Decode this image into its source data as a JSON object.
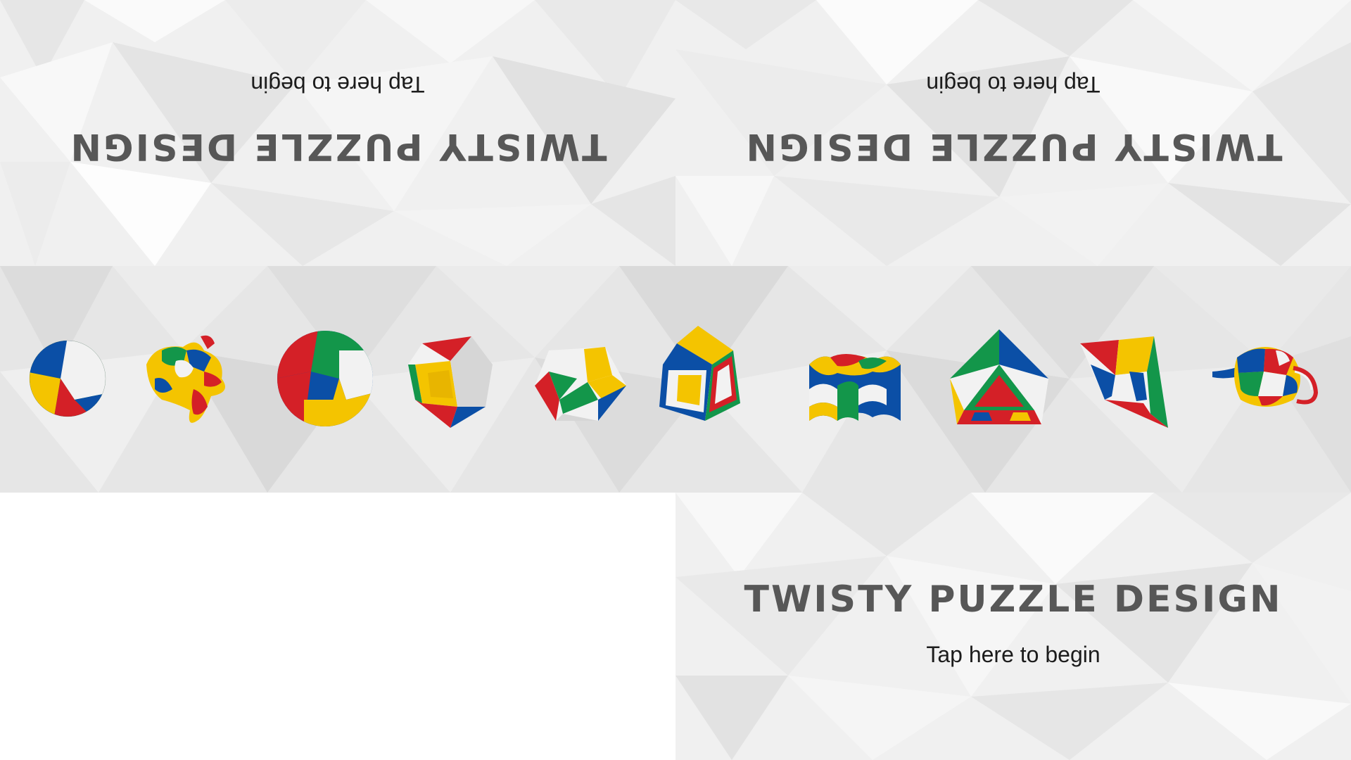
{
  "screen": {
    "title": "TWISTY PUZZLE DESIGN",
    "subtitle": "Tap here to begin"
  },
  "palette": {
    "red": "#d42027",
    "blue": "#0b4fa6",
    "yellow": "#f4c400",
    "green": "#13964a",
    "white": "#f2f2f2",
    "title_gray": "#575757",
    "background_light": "#efefef"
  },
  "puzzles": [
    {
      "name": "sphere-puzzle-small"
    },
    {
      "name": "bunny-puzzle"
    },
    {
      "name": "sphere-puzzle-large"
    },
    {
      "name": "rhombic-cube-puzzle"
    },
    {
      "name": "dodecahedron-puzzle"
    },
    {
      "name": "cube-puzzle"
    },
    {
      "name": "wavy-cylinder-puzzle"
    },
    {
      "name": "octahedron-puzzle"
    },
    {
      "name": "tetrahedron-puzzle"
    },
    {
      "name": "teapot-puzzle"
    }
  ]
}
